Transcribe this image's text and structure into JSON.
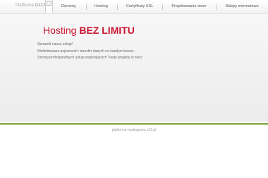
{
  "header": {
    "logo_prefix": "Platforma ",
    "logo_name": "O12.PL"
  },
  "nav": {
    "items": [
      {
        "label": "Domeny"
      },
      {
        "label": "Hosting"
      },
      {
        "label": "Certyfikaty SSL"
      },
      {
        "label": "Projektowanie stron"
      },
      {
        "label": "Sklepy internetowe"
      }
    ]
  },
  "hero": {
    "title_regular": "Hosting ",
    "title_bold": "BEZ LIMITU",
    "lines": [
      "Sprawdź naszą usługi!",
      "Nielimitowana pojemność i transfer danych na każdym koncie.",
      "Szereg profesjonalnych usług wspierających Twoje projekty w sieci."
    ],
    "title_color": "#c9122e"
  },
  "footer": {
    "text": "platforma hostingowa o12.pl"
  },
  "colors": {
    "accent_green": "#7fa83c"
  },
  "icons": {
    "logo_image": "broken-image-icon"
  }
}
